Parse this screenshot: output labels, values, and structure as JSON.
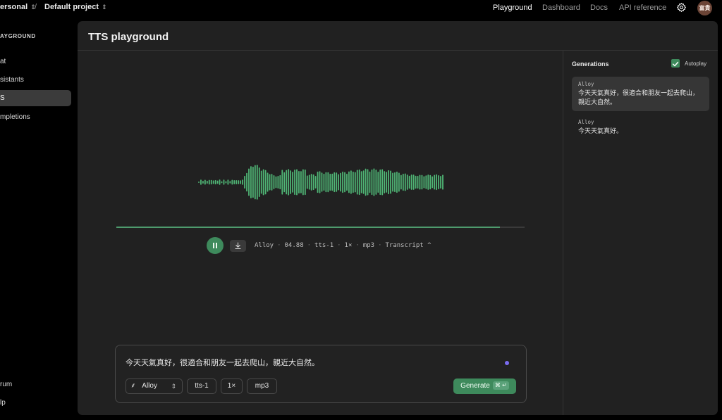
{
  "topbar": {
    "org": "ersonal",
    "project": "Default project",
    "separator": "/",
    "nav": [
      "Playground",
      "Dashboard",
      "Docs",
      "API reference"
    ],
    "active_nav": "Playground",
    "avatar_text": "富貴"
  },
  "sidebar": {
    "section": "AYGROUND",
    "items": [
      {
        "label": "at"
      },
      {
        "label": "sistants"
      },
      {
        "label": "S"
      },
      {
        "label": "mpletions"
      }
    ],
    "bottom": [
      {
        "label": "rum"
      },
      {
        "label": "lp"
      }
    ]
  },
  "main": {
    "title": "TTS playground",
    "player": {
      "progress": 0.94,
      "voice": "Alloy",
      "duration": "04.88",
      "model": "tts-1",
      "speed": "1×",
      "format": "mp3",
      "transcript": "Transcript ^"
    },
    "input": {
      "text": "今天天氣真好，很適合和朋友一起去爬山，親近大自然。",
      "voice": "Alloy",
      "model": "tts-1",
      "speed": "1×",
      "format": "mp3",
      "generate": "Generate",
      "shortcut": "⌘ ↵"
    }
  },
  "generations": {
    "title": "Generations",
    "autoplay_label": "Autoplay",
    "autoplay_checked": true,
    "items": [
      {
        "voice": "Alloy",
        "text": "今天天氣真好，很適合和朋友一起去爬山，親近大自然。"
      },
      {
        "voice": "Alloy",
        "text": "今天天氣真好。"
      }
    ]
  },
  "colors": {
    "accent": "#3e8a5c",
    "waveform": "#4fb575",
    "indicator": "#7a6cf0"
  }
}
